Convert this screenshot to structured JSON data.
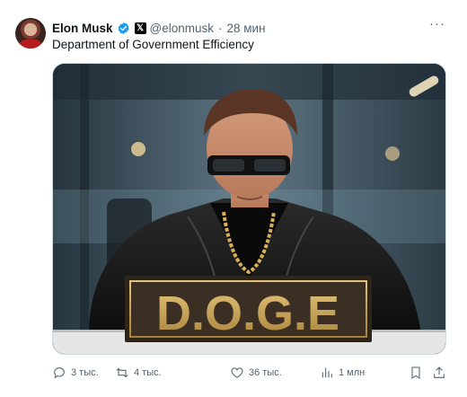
{
  "tweet": {
    "author_name": "Elon Musk",
    "handle": "@elonmusk",
    "separator": "·",
    "time": "28 мин",
    "more_label": "···",
    "text": "Department of Government Efficiency",
    "media": {
      "sign_text": "D.O.G.E"
    },
    "actions": {
      "replies": "3 тыс.",
      "reposts": "4 тыс.",
      "likes": "36 тыс.",
      "views": "1 млн"
    }
  },
  "icons": {
    "verified": "verified-badge-icon",
    "affiliate": "x-logo-icon",
    "reply": "reply-icon",
    "repost": "repost-icon",
    "like": "heart-icon",
    "views": "views-chart-icon",
    "bookmark": "bookmark-icon",
    "share": "share-icon"
  },
  "colors": {
    "verified_blue": "#1d9bf0",
    "text_primary": "#0f1419",
    "text_secondary": "#536471",
    "sign_gold": "#c9a356"
  }
}
